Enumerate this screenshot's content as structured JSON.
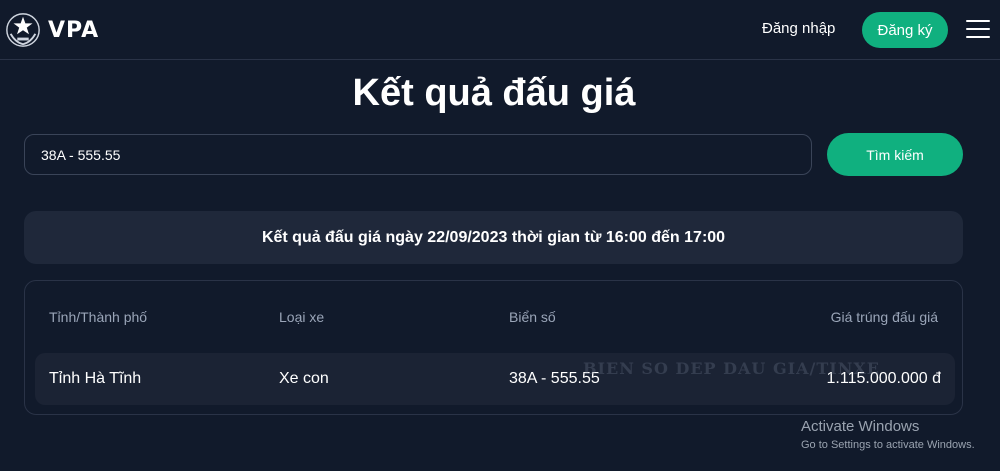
{
  "header": {
    "logo_text": "VPA",
    "login_label": "Đăng nhập",
    "register_label": "Đăng ký",
    "menu_icon": "hamburger-icon"
  },
  "page": {
    "title": "Kết quả đấu giá"
  },
  "search": {
    "value": "38A - 555.55",
    "button_label": "Tìm kiếm"
  },
  "result": {
    "banner": "Kết quả đấu giá ngày 22/09/2023 thời gian từ 16:00 đến 17:00",
    "columns": [
      "Tỉnh/Thành phố",
      "Loại xe",
      "Biển số",
      "Giá trúng đấu giá"
    ],
    "rows": [
      [
        "Tỉnh Hà Tĩnh",
        "Xe con",
        "38A - 555.55",
        "1.115.000.000 đ"
      ]
    ],
    "watermark": "BIEN SO DEP DAU GIA/TINXE"
  },
  "windows_overlay": {
    "title": "Activate Windows",
    "subtitle": "Go to Settings to activate Windows."
  },
  "colors": {
    "background": "#111a2b",
    "accent": "#10b07f",
    "panel": "#1f283a"
  }
}
